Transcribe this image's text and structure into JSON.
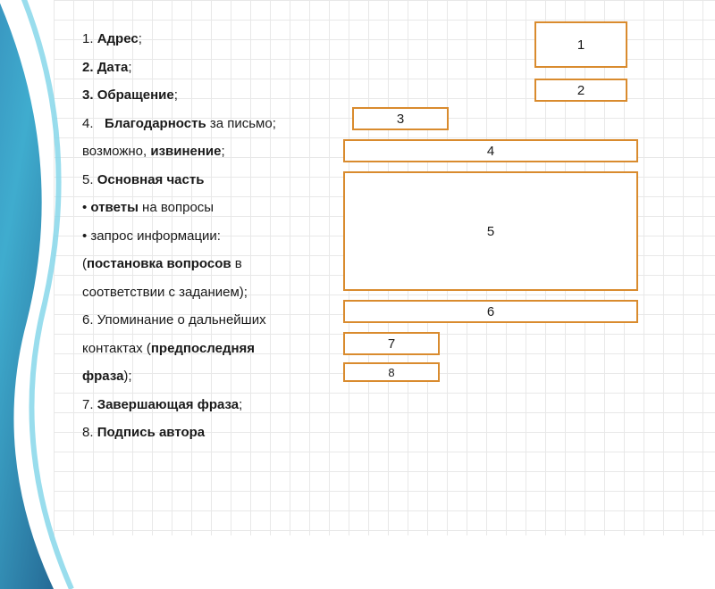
{
  "list": {
    "i1_num": "1. ",
    "i1_b": "Адрес",
    "i1_tail": ";",
    "i2_num": "2. ",
    "i2_b": "Дата",
    "i2_tail": ";",
    "i3_num": "3. ",
    "i3_b": "Обращение",
    "i3_tail": ";",
    "i4_num": "4. ",
    "i4_b_a": "Благодарность",
    "i4_mid": " за письмо;",
    "i4_line2_a": "возможно, ",
    "i4_line2_b": "извинение",
    "i4_line2_tail": ";",
    "i5_num": "5. ",
    "i5_b": "Основная часть",
    "i5_bul1": "• ",
    "i5_bul1_b": "ответы",
    "i5_bul1_tail": " на вопросы",
    "i5_bul2": "• запрос информации:",
    "i5_paren_a": "(",
    "i5_paren_b": "постановка вопросов",
    "i5_paren_mid": " в",
    "i5_paren_line2": "соответствии с заданием);",
    "i6_num": "6. ",
    "i6_a": "Упоминание о дальнейших",
    "i6_line2_a": "контактах (",
    "i6_line2_b": "предпоследняя",
    "i6_line3_b": "фраза",
    "i6_line3_tail": ");",
    "i7_num": "7. ",
    "i7_b": "Завершающая  фраза",
    "i7_tail": ";",
    "i8_num": "8. ",
    "i8_b": "Подпись автора"
  },
  "boxes": {
    "b1": "1",
    "b2": "2",
    "b3": "3",
    "b4": "4",
    "b5": "5",
    "b6": "6",
    "b7": "7",
    "b8": "8"
  }
}
